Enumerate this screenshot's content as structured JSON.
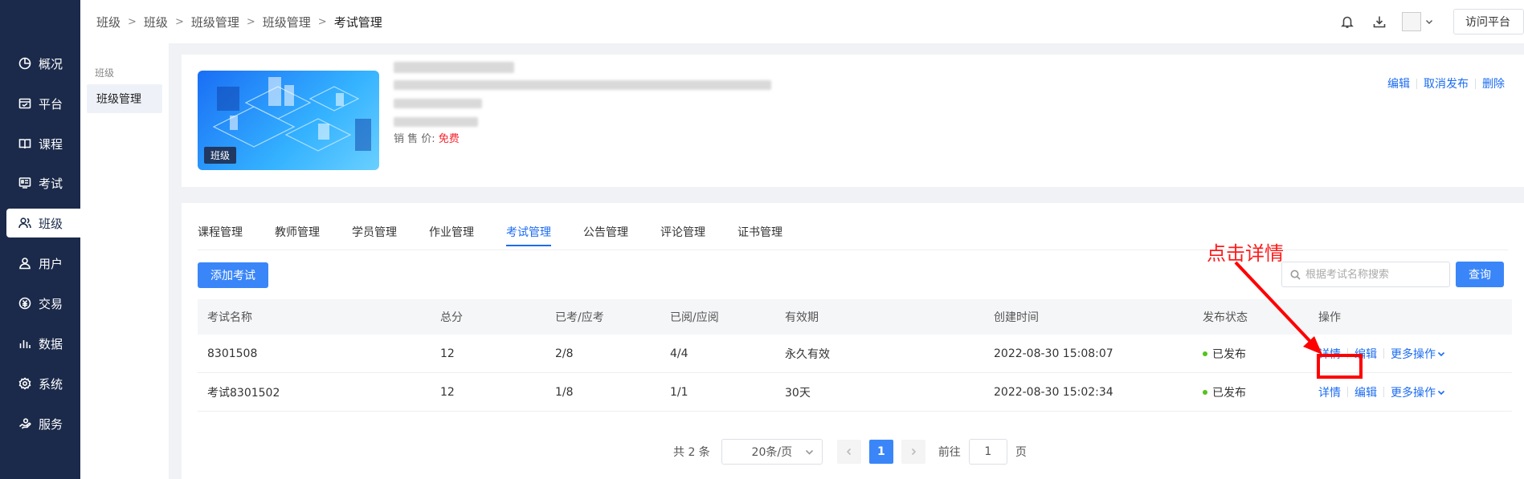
{
  "nav": {
    "items": [
      {
        "label": "概况",
        "icon": "pie-chart-icon"
      },
      {
        "label": "平台",
        "icon": "platform-icon"
      },
      {
        "label": "课程",
        "icon": "book-icon"
      },
      {
        "label": "考试",
        "icon": "exam-icon"
      },
      {
        "label": "班级",
        "icon": "users-icon",
        "active": true
      },
      {
        "label": "用户",
        "icon": "user-icon"
      },
      {
        "label": "交易",
        "icon": "transaction-icon"
      },
      {
        "label": "数据",
        "icon": "bar-chart-icon"
      },
      {
        "label": "系统",
        "icon": "settings-icon"
      },
      {
        "label": "服务",
        "icon": "service-icon"
      }
    ]
  },
  "breadcrumb": [
    "班级",
    "班级",
    "班级管理",
    "班级管理",
    "考试管理"
  ],
  "topbar": {
    "visit_label": "访问平台"
  },
  "subnav": {
    "group": "班级",
    "item": "班级管理"
  },
  "card": {
    "thumb_tag": "班级",
    "price_label": "销 售 价:",
    "price_value": "免费",
    "actions": [
      "编辑",
      "取消发布",
      "删除"
    ]
  },
  "tabs": [
    "课程管理",
    "教师管理",
    "学员管理",
    "作业管理",
    "考试管理",
    "公告管理",
    "评论管理",
    "证书管理"
  ],
  "active_tab": "考试管理",
  "toolbar": {
    "add_label": "添加考试",
    "search_placeholder": "根据考试名称搜索",
    "query_label": "查询"
  },
  "table": {
    "headers": [
      "考试名称",
      "总分",
      "已考/应考",
      "已阅/应阅",
      "有效期",
      "创建时间",
      "发布状态",
      "操作"
    ],
    "rows": [
      {
        "name": "8301508",
        "score": "12",
        "taken": "2/8",
        "reviewed": "4/4",
        "validity": "永久有效",
        "created": "2022-08-30 15:08:07",
        "status": "已发布"
      },
      {
        "name": "考试8301502",
        "score": "12",
        "taken": "1/8",
        "reviewed": "1/1",
        "validity": "30天",
        "created": "2022-08-30 15:02:34",
        "status": "已发布"
      }
    ],
    "ops": {
      "detail": "详情",
      "edit": "编辑",
      "more": "更多操作"
    }
  },
  "pagination": {
    "total": "共 2 条",
    "page_size": "20条/页",
    "current": "1",
    "goto_label": "前往",
    "goto_value": "1",
    "page_unit": "页"
  },
  "annotation": {
    "text": "点击详情",
    "color": "#ff0000"
  },
  "colors": {
    "accent": "#3a86f8",
    "nav_bg": "#1b2a4a",
    "status_green": "#52c41a",
    "price_red": "#f5222d"
  }
}
